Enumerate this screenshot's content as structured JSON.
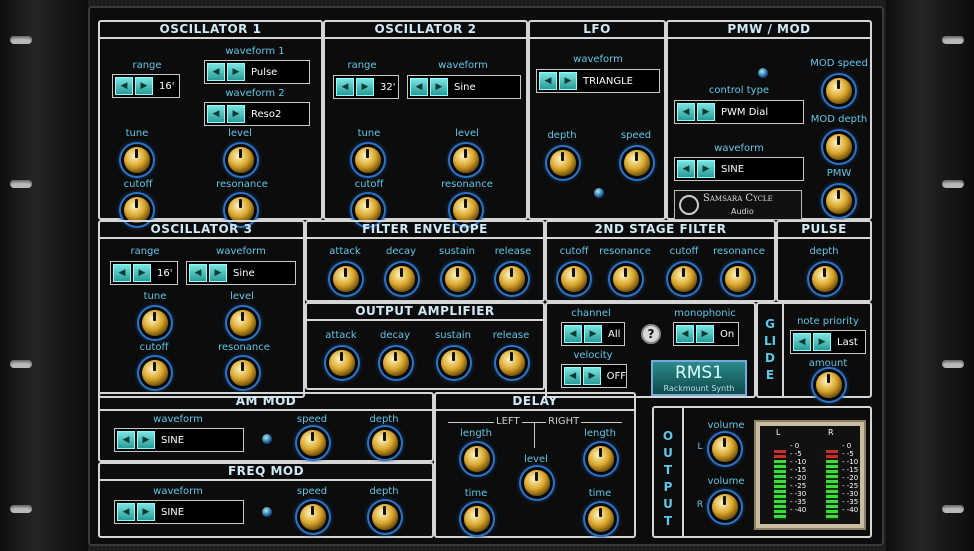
{
  "osc1": {
    "title": "OSCILLATOR 1",
    "range_label": "range",
    "range_value": "16'",
    "wf1_label": "waveform 1",
    "wf1_value": "Pulse",
    "wf2_label": "waveform 2",
    "wf2_value": "Reso2",
    "tune": "tune",
    "level": "level",
    "cutoff": "cutoff",
    "resonance": "resonance"
  },
  "osc2": {
    "title": "OSCILLATOR 2",
    "range_label": "range",
    "range_value": "32'",
    "wf_label": "waveform",
    "wf_value": "Sine",
    "tune": "tune",
    "level": "level",
    "cutoff": "cutoff",
    "resonance": "resonance"
  },
  "lfo": {
    "title": "LFO",
    "wf_label": "waveform",
    "wf_value": "TRIANGLE",
    "depth": "depth",
    "speed": "speed"
  },
  "pmw": {
    "title": "PMW / MOD",
    "ct_label": "control type",
    "ct_value": "PWM Dial",
    "wf_label": "waveform",
    "wf_value": "SINE",
    "mod_speed": "MOD speed",
    "mod_depth": "MOD depth",
    "pmw": "PMW",
    "logo_top": "Samsara Cycle",
    "logo_bottom": "Audio"
  },
  "osc3": {
    "title": "OSCILLATOR 3",
    "range_label": "range",
    "range_value": "16'",
    "wf_label": "waveform",
    "wf_value": "Sine",
    "tune": "tune",
    "level": "level",
    "cutoff": "cutoff",
    "resonance": "resonance"
  },
  "fenv": {
    "title": "FILTER ENVELOPE",
    "attack": "attack",
    "decay": "decay",
    "sustain": "sustain",
    "release": "release"
  },
  "sf": {
    "title": "2ND STAGE FILTER",
    "cutoff1": "cutoff",
    "res1": "resonance",
    "cutoff2": "cutoff",
    "res2": "resonance"
  },
  "pulse": {
    "title": "PULSE",
    "depth": "depth"
  },
  "oamp": {
    "title": "OUTPUT AMPLIFIER",
    "attack": "attack",
    "decay": "decay",
    "sustain": "sustain",
    "release": "release"
  },
  "misc": {
    "channel_label": "channel",
    "channel_value": "All",
    "mono_label": "monophonic",
    "mono_value": "On",
    "velocity_label": "velocity",
    "velocity_value": "OFF",
    "help": "?",
    "rms_title": "RMS1",
    "rms_sub": "Rackmount Synth"
  },
  "glide": {
    "title": "GLIDE",
    "np_label": "note priority",
    "np_value": "Last",
    "amount": "amount"
  },
  "am": {
    "title": "AM MOD",
    "wf_label": "waveform",
    "wf_value": "SINE",
    "speed": "speed",
    "depth": "depth"
  },
  "fm": {
    "title": "FREQ MOD",
    "wf_label": "waveform",
    "wf_value": "SINE",
    "speed": "speed",
    "depth": "depth"
  },
  "delay": {
    "title": "DELAY",
    "left": "LEFT",
    "right": "RIGHT",
    "length_l": "length",
    "length_r": "length",
    "level": "level",
    "time_l": "time",
    "time_r": "time"
  },
  "output": {
    "title": "OUTPUT",
    "volume_l": "volume",
    "volume_r": "volume",
    "l": "L",
    "r": "R",
    "meter_l": "L",
    "meter_r": "R",
    "scale": "- 0\n- -5\n- -10\n- -15\n- -20\n- -25\n- -30\n- -35\n- -40"
  },
  "arrows": {
    "left": "◀",
    "right": "▶"
  }
}
